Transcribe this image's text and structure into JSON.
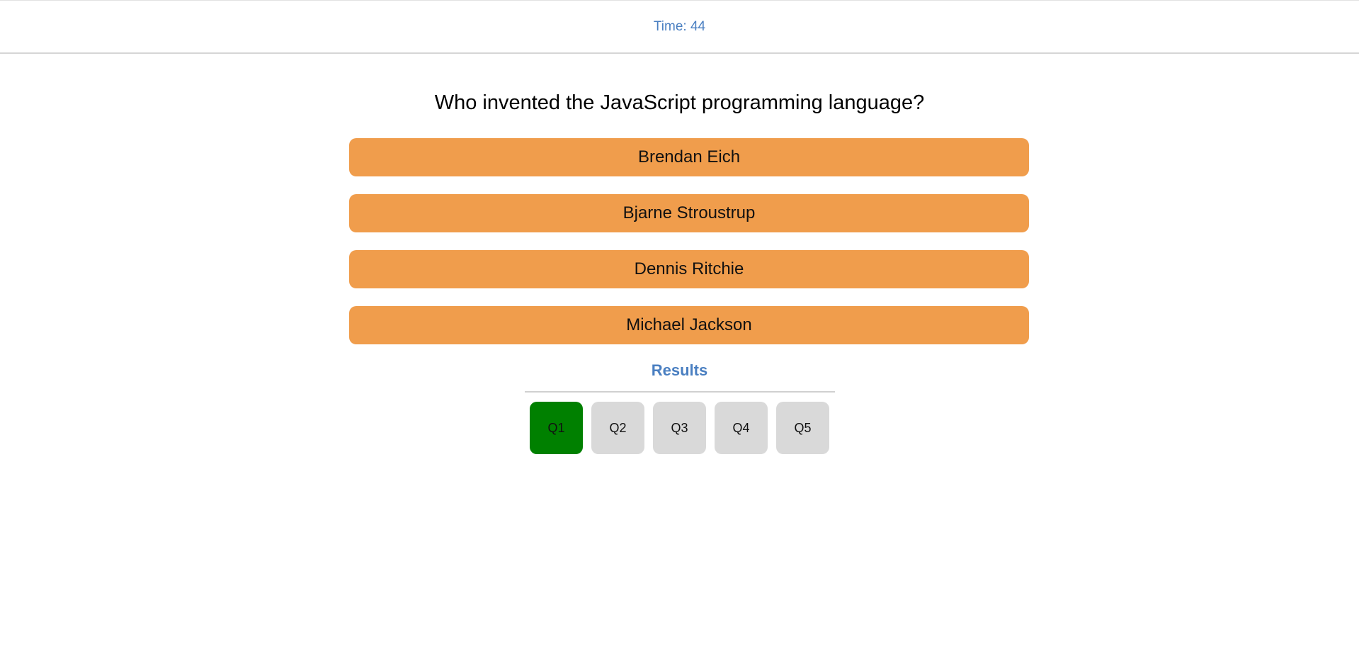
{
  "header": {
    "timer_text": "Time: 44"
  },
  "question": {
    "text": "Who invented the JavaScript programming language?"
  },
  "answers": [
    {
      "label": "Brendan Eich"
    },
    {
      "label": "Bjarne Stroustrup"
    },
    {
      "label": "Dennis Ritchie"
    },
    {
      "label": "Michael Jackson"
    }
  ],
  "results": {
    "title": "Results",
    "items": [
      {
        "label": "Q1",
        "status": "correct"
      },
      {
        "label": "Q2",
        "status": "unanswered"
      },
      {
        "label": "Q3",
        "status": "unanswered"
      },
      {
        "label": "Q4",
        "status": "unanswered"
      },
      {
        "label": "Q5",
        "status": "unanswered"
      }
    ]
  },
  "colors": {
    "accent": "#4a7fc1",
    "answer_bg": "#f09d4c",
    "correct": "#008000",
    "unanswered": "#d9d9d9"
  }
}
